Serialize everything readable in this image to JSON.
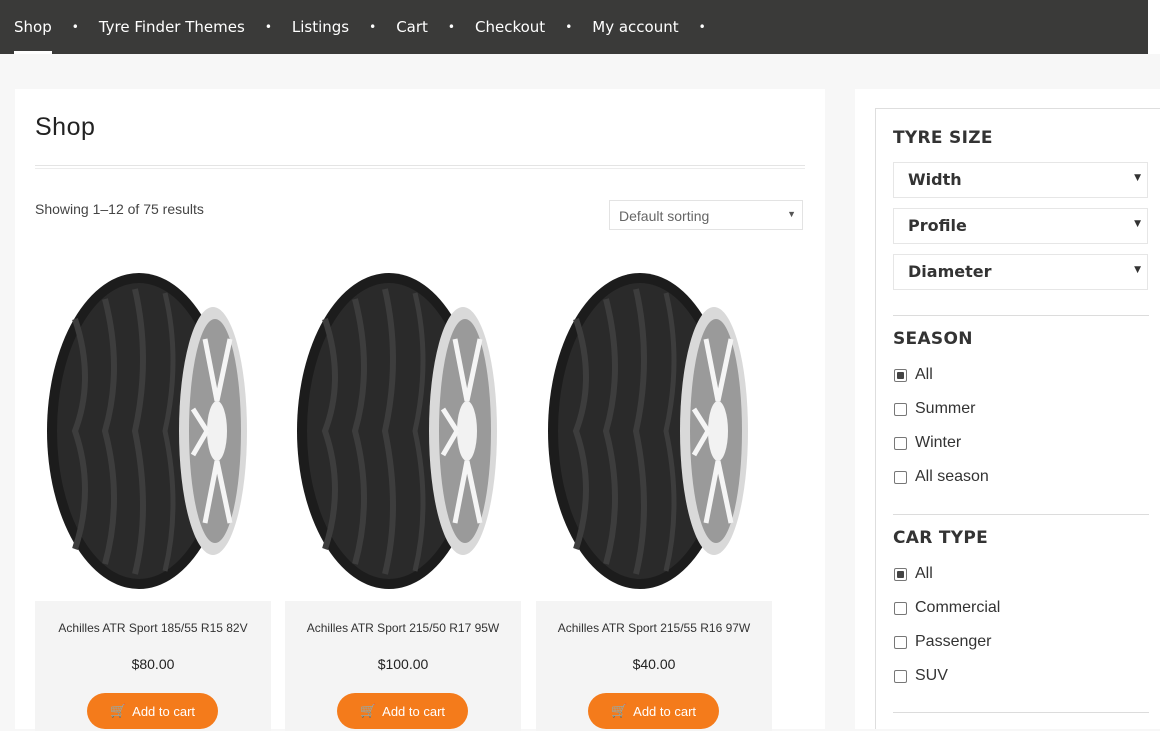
{
  "nav": {
    "items": [
      {
        "label": "Shop"
      },
      {
        "label": "Tyre Finder Themes"
      },
      {
        "label": "Listings"
      },
      {
        "label": "Cart"
      },
      {
        "label": "Checkout"
      },
      {
        "label": "My account"
      }
    ],
    "separator": "•"
  },
  "main": {
    "title": "Shop",
    "result_count": "Showing 1–12 of 75 results",
    "sorting": {
      "selected": "Default sorting"
    }
  },
  "products": [
    {
      "name": "Achilles ATR Sport 185/55 R15 82V",
      "price": "$80.00",
      "button": "Add to cart"
    },
    {
      "name": "Achilles ATR Sport 215/50 R17 95W",
      "price": "$100.00",
      "button": "Add to cart"
    },
    {
      "name": "Achilles ATR Sport 215/55 R16 97W",
      "price": "$40.00",
      "button": "Add to cart"
    }
  ],
  "sidebar": {
    "tyre_size": {
      "title": "TYRE SIZE",
      "dropdowns": [
        {
          "label": "Width"
        },
        {
          "label": "Profile"
        },
        {
          "label": "Diameter"
        }
      ]
    },
    "season": {
      "title": "SEASON",
      "options": [
        {
          "label": "All",
          "checked": true
        },
        {
          "label": "Summer",
          "checked": false
        },
        {
          "label": "Winter",
          "checked": false
        },
        {
          "label": "All season",
          "checked": false
        }
      ]
    },
    "car_type": {
      "title": "CAR TYPE",
      "options": [
        {
          "label": "All",
          "checked": true
        },
        {
          "label": "Commercial",
          "checked": false
        },
        {
          "label": "Passenger",
          "checked": false
        },
        {
          "label": "SUV",
          "checked": false
        }
      ]
    }
  },
  "colors": {
    "topbar": "#3a3a39",
    "accent": "#f47b1b"
  }
}
